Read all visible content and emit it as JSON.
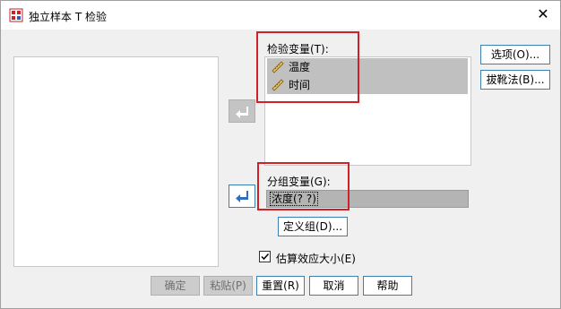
{
  "window": {
    "title": "独立样本 T 检验",
    "close_glyph": "✕"
  },
  "source_list": {
    "items": []
  },
  "test_variables": {
    "label": "检验变量(T):",
    "items": [
      {
        "label": "温度",
        "icon": "scale-ruler-icon"
      },
      {
        "label": "时间",
        "icon": "scale-ruler-icon"
      }
    ]
  },
  "grouping_variable": {
    "label": "分组变量(G):",
    "value": "浓度(? ?)",
    "define_groups_label": "定义组(D)..."
  },
  "side_buttons": {
    "options_label": "选项(O)...",
    "bootstrap_label": "拔靴法(B)..."
  },
  "effect_size": {
    "label": "估算效应大小(E)",
    "checked": true
  },
  "footer": {
    "ok_label": "确定",
    "paste_label": "粘贴(P)",
    "reset_label": "重置(R)",
    "cancel_label": "取消",
    "help_label": "帮助"
  },
  "colors": {
    "highlight_box": "#d0202a",
    "arrow_blue": "#2f6fbf",
    "selection_gray": "#c0c0c0"
  }
}
